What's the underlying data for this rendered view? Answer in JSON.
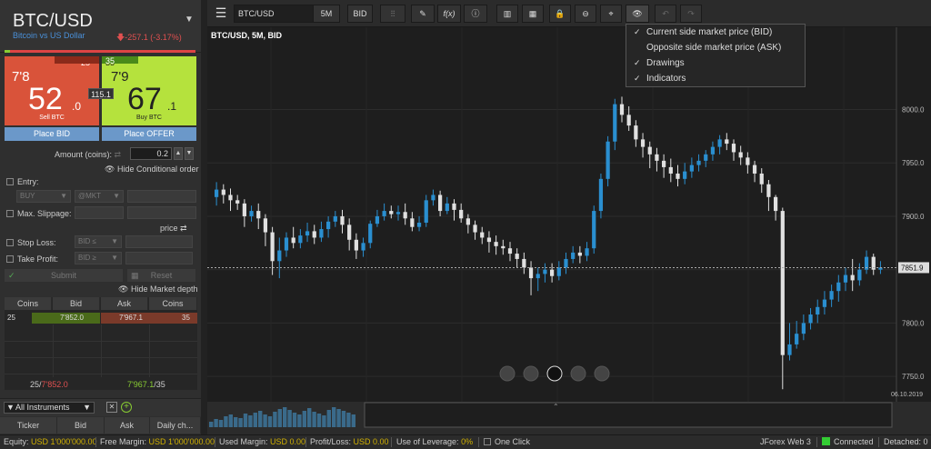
{
  "instrument": {
    "title": "BTC/USD",
    "subtitle": "Bitcoin vs US Dollar",
    "change": "-257.1 (-3.17%)"
  },
  "sell": {
    "volume": "25",
    "small": "7'8",
    "big": "52",
    "pip": ".0",
    "label": "Sell BTC"
  },
  "buy": {
    "volume": "35",
    "small": "7'9",
    "big": "67",
    "pip": ".1",
    "label": "Buy BTC"
  },
  "spread": "115.1",
  "buttons": {
    "place_bid": "Place BID",
    "place_offer": "Place OFFER",
    "submit": "Submit",
    "reset": "Reset"
  },
  "amount": {
    "label": "Amount (coins):",
    "value": "0.2"
  },
  "links": {
    "hide_conditional": "Hide Conditional order",
    "hide_depth": "Hide Market depth"
  },
  "conditional": {
    "entry_label": "Entry:",
    "entry_side": "BUY",
    "entry_type": "@MKT",
    "slippage_label": "Max. Slippage:",
    "price_label": "price",
    "stop_loss_label": "Stop Loss:",
    "stop_loss_cond": "BID ≤",
    "take_profit_label": "Take Profit:",
    "take_profit_cond": "BID ≥"
  },
  "depth": {
    "headers": [
      "Coins",
      "Bid",
      "Ask",
      "Coins"
    ],
    "row": {
      "bid_coins": "25",
      "bid": "7'852.0",
      "ask": "7'967.1",
      "ask_coins": "35"
    },
    "total_left_coins": "25/",
    "total_left_price": "7'852.0",
    "total_right_price": "7'967.1",
    "total_right_coins": "/35"
  },
  "instruments_bar": {
    "selected": "All Instruments",
    "headers": [
      "Ticker",
      "Bid",
      "Ask",
      "Daily ch..."
    ]
  },
  "toolbar": {
    "symbol": "BTC/USD",
    "period": "5M",
    "side": "BID",
    "fx": "f(x)"
  },
  "chart_title": "BTC/USD, 5M, BID",
  "view_menu": [
    {
      "label": "Current side market price (BID)",
      "checked": true
    },
    {
      "label": "Opposite side market price (ASK)",
      "checked": false
    },
    {
      "label": "Drawings",
      "checked": true
    },
    {
      "label": "Indicators",
      "checked": true
    }
  ],
  "chart_data": {
    "type": "candlestick",
    "title": "BTC/USD, 5M, BID",
    "y_ticks": [
      8000.0,
      7950.0,
      7900.0,
      7850.0,
      7800.0,
      7750.0
    ],
    "ylim": [
      7728,
      8060
    ],
    "current_price": 7851.9,
    "current_price_label": "7851.9",
    "date_label": "06.10.2019",
    "candles": [
      [
        7918,
        7925,
        7910,
        7932
      ],
      [
        7925,
        7920,
        7912,
        7930
      ],
      [
        7920,
        7915,
        7905,
        7926
      ],
      [
        7915,
        7912,
        7906,
        7920
      ],
      [
        7912,
        7900,
        7890,
        7916
      ],
      [
        7900,
        7905,
        7895,
        7910
      ],
      [
        7905,
        7898,
        7888,
        7912
      ],
      [
        7898,
        7885,
        7872,
        7902
      ],
      [
        7885,
        7858,
        7845,
        7890
      ],
      [
        7858,
        7868,
        7842,
        7880
      ],
      [
        7868,
        7880,
        7862,
        7885
      ],
      [
        7880,
        7875,
        7870,
        7890
      ],
      [
        7875,
        7882,
        7870,
        7888
      ],
      [
        7882,
        7886,
        7876,
        7894
      ],
      [
        7886,
        7880,
        7874,
        7892
      ],
      [
        7880,
        7888,
        7876,
        7895
      ],
      [
        7888,
        7895,
        7880,
        7900
      ],
      [
        7895,
        7900,
        7890,
        7905
      ],
      [
        7900,
        7892,
        7884,
        7906
      ],
      [
        7892,
        7878,
        7868,
        7898
      ],
      [
        7878,
        7868,
        7860,
        7884
      ],
      [
        7868,
        7875,
        7862,
        7880
      ],
      [
        7875,
        7893,
        7870,
        7896
      ],
      [
        7893,
        7900,
        7890,
        7906
      ],
      [
        7900,
        7905,
        7896,
        7912
      ],
      [
        7905,
        7902,
        7898,
        7910
      ],
      [
        7902,
        7904,
        7896,
        7910
      ],
      [
        7904,
        7898,
        7892,
        7912
      ],
      [
        7898,
        7890,
        7886,
        7904
      ],
      [
        7890,
        7894,
        7886,
        7900
      ],
      [
        7894,
        7915,
        7890,
        7920
      ],
      [
        7915,
        7920,
        7910,
        7925
      ],
      [
        7920,
        7905,
        7900,
        7924
      ],
      [
        7905,
        7912,
        7902,
        7918
      ],
      [
        7912,
        7906,
        7896,
        7916
      ],
      [
        7906,
        7898,
        7894,
        7912
      ],
      [
        7898,
        7892,
        7884,
        7902
      ],
      [
        7892,
        7885,
        7878,
        7896
      ],
      [
        7885,
        7880,
        7874,
        7890
      ],
      [
        7880,
        7876,
        7866,
        7886
      ],
      [
        7876,
        7872,
        7864,
        7882
      ],
      [
        7872,
        7870,
        7864,
        7878
      ],
      [
        7870,
        7865,
        7858,
        7876
      ],
      [
        7865,
        7860,
        7852,
        7870
      ],
      [
        7860,
        7852,
        7846,
        7866
      ],
      [
        7852,
        7842,
        7826,
        7858
      ],
      [
        7842,
        7846,
        7830,
        7852
      ],
      [
        7846,
        7850,
        7838,
        7856
      ],
      [
        7850,
        7844,
        7838,
        7856
      ],
      [
        7844,
        7852,
        7840,
        7858
      ],
      [
        7852,
        7860,
        7846,
        7866
      ],
      [
        7860,
        7866,
        7856,
        7872
      ],
      [
        7866,
        7863,
        7856,
        7872
      ],
      [
        7863,
        7870,
        7858,
        7876
      ],
      [
        7870,
        7905,
        7865,
        7910
      ],
      [
        7905,
        7935,
        7898,
        7940
      ],
      [
        7935,
        7970,
        7928,
        7975
      ],
      [
        7970,
        8005,
        7962,
        8010
      ],
      [
        8005,
        7995,
        7988,
        8012
      ],
      [
        7995,
        7985,
        7980,
        8003
      ],
      [
        7985,
        7972,
        7965,
        7990
      ],
      [
        7972,
        7965,
        7955,
        7978
      ],
      [
        7965,
        7958,
        7945,
        7970
      ],
      [
        7958,
        7952,
        7942,
        7964
      ],
      [
        7952,
        7946,
        7936,
        7958
      ],
      [
        7946,
        7940,
        7932,
        7954
      ],
      [
        7940,
        7935,
        7928,
        7948
      ],
      [
        7935,
        7942,
        7930,
        7950
      ],
      [
        7942,
        7948,
        7936,
        7955
      ],
      [
        7948,
        7952,
        7942,
        7958
      ],
      [
        7952,
        7958,
        7946,
        7962
      ],
      [
        7958,
        7965,
        7952,
        7970
      ],
      [
        7965,
        7972,
        7958,
        7976
      ],
      [
        7972,
        7968,
        7962,
        7978
      ],
      [
        7968,
        7960,
        7952,
        7972
      ],
      [
        7960,
        7955,
        7948,
        7966
      ],
      [
        7955,
        7948,
        7940,
        7960
      ],
      [
        7948,
        7940,
        7932,
        7952
      ],
      [
        7940,
        7930,
        7922,
        7945
      ],
      [
        7930,
        7918,
        7905,
        7934
      ],
      [
        7918,
        7905,
        7896,
        7920
      ],
      [
        7905,
        7770,
        7738,
        7908
      ],
      [
        7770,
        7780,
        7765,
        7800
      ],
      [
        7780,
        7790,
        7776,
        7802
      ],
      [
        7790,
        7800,
        7784,
        7808
      ],
      [
        7800,
        7808,
        7794,
        7814
      ],
      [
        7808,
        7815,
        7800,
        7822
      ],
      [
        7815,
        7822,
        7808,
        7830
      ],
      [
        7822,
        7830,
        7815,
        7836
      ],
      [
        7830,
        7838,
        7820,
        7845
      ],
      [
        7838,
        7845,
        7830,
        7852
      ],
      [
        7845,
        7840,
        7830,
        7860
      ],
      [
        7840,
        7850,
        7835,
        7856
      ],
      [
        7850,
        7862,
        7846,
        7868
      ],
      [
        7862,
        7850,
        7845,
        7865
      ],
      [
        7850,
        7852,
        7846,
        7858
      ]
    ]
  },
  "status": {
    "equity_label": "Equity:",
    "equity": "USD 1'000'000.00",
    "free_margin_label": "Free Margin:",
    "free_margin": "USD 1'000'000.00",
    "used_margin_label": "Used Margin:",
    "used_margin": "USD 0.00",
    "pl_label": "Profit/Loss:",
    "pl": "USD 0.00",
    "leverage_label": "Use of Leverage:",
    "leverage": "0%",
    "one_click": "One Click",
    "platform": "JForex Web 3",
    "connection": "Connected",
    "detached": "Detached: 0"
  },
  "colors": {
    "sell": "#d9533a",
    "buy": "#b5e23d",
    "candle_up": "#2a8fd0",
    "candle_down": "#e0e0e0",
    "accent": "#6b98c9"
  }
}
